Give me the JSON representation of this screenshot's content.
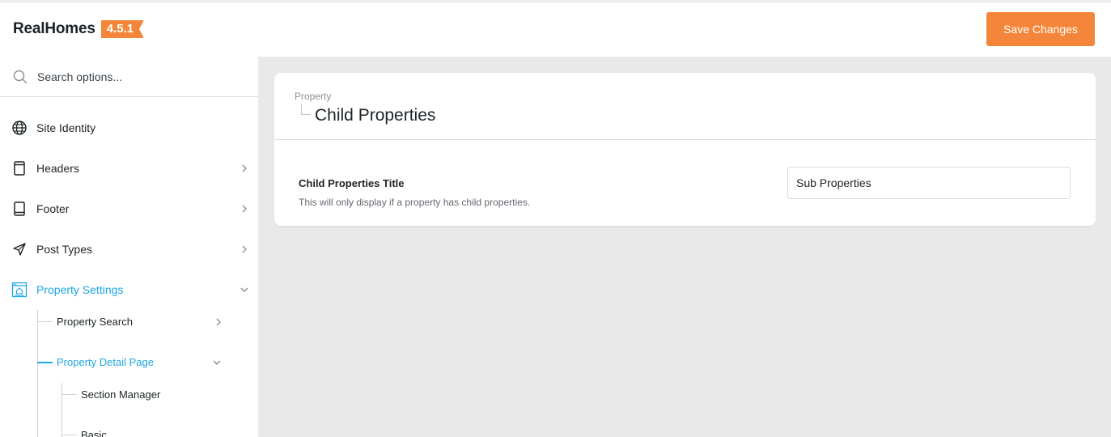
{
  "brand": {
    "name": "RealHomes",
    "version": "4.5.1"
  },
  "toolbar": {
    "save_label": "Save Changes"
  },
  "search": {
    "placeholder": "Search options..."
  },
  "sidebar": {
    "items": [
      {
        "label": "Site Identity",
        "icon": "globe-icon",
        "has_chevron": false
      },
      {
        "label": "Headers",
        "icon": "page-icon",
        "has_chevron": true
      },
      {
        "label": "Footer",
        "icon": "page-icon",
        "has_chevron": true
      },
      {
        "label": "Post Types",
        "icon": "send-icon",
        "has_chevron": true
      },
      {
        "label": "Property Settings",
        "icon": "property-settings-icon",
        "has_chevron": true,
        "expanded": true,
        "active": true
      }
    ],
    "sub_items": [
      {
        "label": "Property Search",
        "has_chevron": true
      },
      {
        "label": "Property Detail Page",
        "has_chevron": true,
        "expanded": true,
        "active": true
      }
    ],
    "sub_sub_items": [
      {
        "label": "Section Manager"
      },
      {
        "label": "Basic"
      }
    ]
  },
  "panel": {
    "breadcrumb": "Property",
    "title": "Child Properties",
    "field": {
      "label": "Child Properties Title",
      "description": "This will only display if a property has child properties.",
      "value": "Sub Properties"
    }
  },
  "colors": {
    "accent": "#f3863a",
    "active": "#1ea7e0",
    "background": "#e9e9e9"
  }
}
